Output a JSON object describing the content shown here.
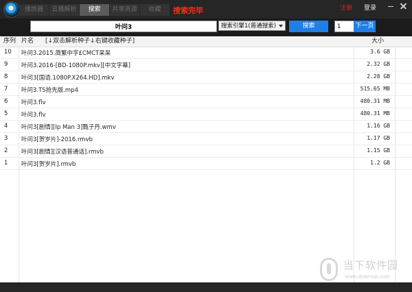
{
  "app": {
    "status_text": "搜索完毕",
    "register_label": "注册",
    "login_label": "登录"
  },
  "tabs": [
    {
      "label": "播放器",
      "active": false
    },
    {
      "label": "云播解析",
      "active": false
    },
    {
      "label": "搜索",
      "active": true
    },
    {
      "label": "共享资源",
      "active": false
    },
    {
      "label": "收藏",
      "active": false
    }
  ],
  "search": {
    "query": "叶问3",
    "engine_selected": "搜索引擎1(普通搜索)",
    "search_button": "搜索",
    "page_number": "1",
    "next_page_button": "下一页"
  },
  "table": {
    "headers": {
      "index": "序列",
      "name": "片名",
      "hint": "[↓双击解析种子↓右键收藏种子]",
      "size": "大小"
    },
    "rows": [
      {
        "index": "10",
        "name": "叶问3.2015.简繁中字£CMCT呆呆",
        "size": "3.6 GB"
      },
      {
        "index": "9",
        "name": "叶问3.2016-[BD-1080P.mkv][中文字幕]",
        "size": "2.32 GB"
      },
      {
        "index": "8",
        "name": "叶问3[国语.1080P.X264.HD].mkv",
        "size": "2.28 GB"
      },
      {
        "index": "7",
        "name": "叶问3.TS抢先版.mp4",
        "size": "515.65 MB"
      },
      {
        "index": "6",
        "name": "叶问3.flv",
        "size": "480.31 MB"
      },
      {
        "index": "5",
        "name": "叶问3.flv",
        "size": "480.31 MB"
      },
      {
        "index": "4",
        "name": "叶问3[剧情][Ip Man 3]甄子丹.wmv",
        "size": "1.16 GB"
      },
      {
        "index": "3",
        "name": "叶问3[贺岁片]-2016.rmvb",
        "size": "1.17 GB"
      },
      {
        "index": "2",
        "name": "叶问3[剧情][汉语普通话].rmvb",
        "size": "1.15 GB"
      },
      {
        "index": "1",
        "name": "叶问3[贺岁片].rmvb",
        "size": "1.2 GB"
      }
    ]
  },
  "watermark": {
    "main_text": "当下软件园",
    "sub_text": "www.downxia.com"
  },
  "colors": {
    "accent_blue": "#1f7fe6",
    "status_red": "#ff2a1a",
    "titlebar": "#262626"
  }
}
